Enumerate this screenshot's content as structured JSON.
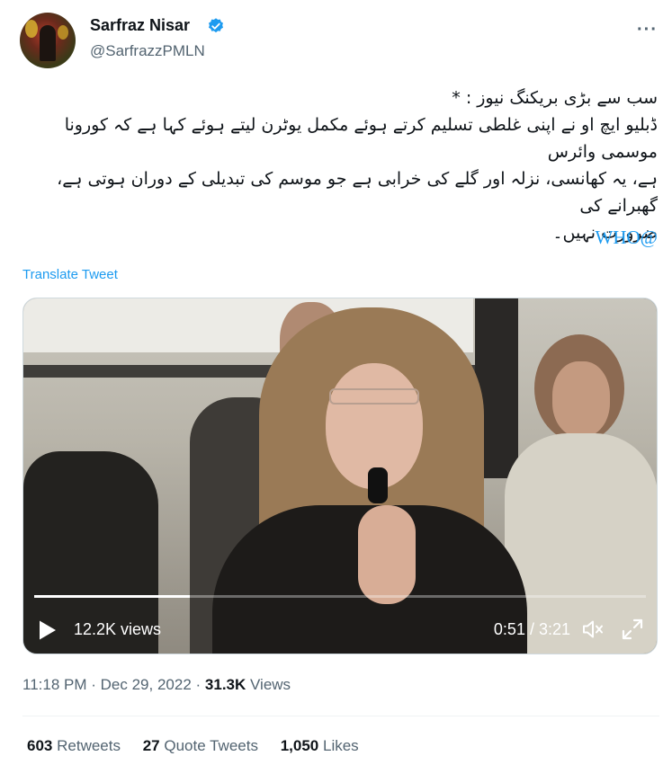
{
  "author": {
    "name": "Sarfraz Nisar",
    "handle": "@SarfrazzPMLN",
    "verified_color": "#1d9bf0"
  },
  "tweet": {
    "lines": [
      "سب سے بڑی بریکنگ نیوز : *",
      "ڈبلیو ایچ او نے اپنی غلطی تسلیم کرتے ہوئے مکمل یوٹرن لیتے ہوئے کہا ہے کہ کورونا موسمی وائرس",
      "ہے، یہ کھانسی، نزلہ اور گلے کی خرابی ہے جو موسم کی تبدیلی کے دوران ہوتی ہے، گھبرانے کی",
      "ضرورت نہیں۔"
    ],
    "mention": "WHO@",
    "translate_label": "Translate Tweet"
  },
  "video": {
    "views_label": "12.2K views",
    "time_label": "0:51 / 3:21",
    "progress_fraction": 0.254
  },
  "meta": {
    "time": "11:18 PM",
    "date": "Dec 29, 2022",
    "views_count": "31.3K",
    "views_word": "Views"
  },
  "stats": {
    "retweets_count": "603",
    "retweets_label": "Retweets",
    "quotes_count": "27",
    "quotes_label": "Quote Tweets",
    "likes_count": "1,050",
    "likes_label": "Likes"
  },
  "colors": {
    "accent": "#1d9bf0",
    "secondary_text": "#536471"
  }
}
